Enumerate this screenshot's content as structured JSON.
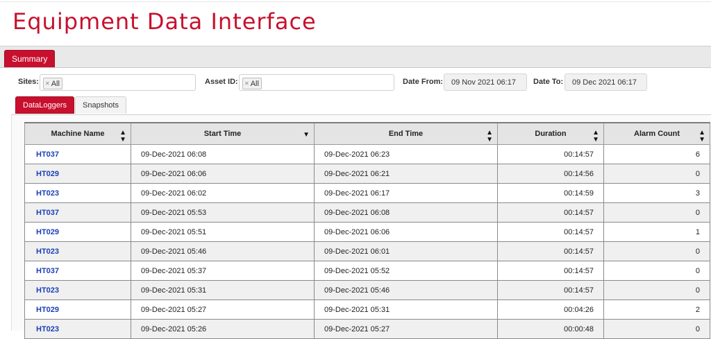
{
  "header": {
    "title": "Equipment Data Interface"
  },
  "tabs": {
    "summary": "Summary"
  },
  "filters": {
    "sites_label": "Sites:",
    "sites_chip": "All",
    "asset_label": "Asset ID:",
    "asset_chip": "All",
    "date_from_label": "Date From:",
    "date_from_value": "09 Nov 2021 06:17",
    "date_to_label": "Date To:",
    "date_to_value": "09 Dec 2021 06:17"
  },
  "subtabs": {
    "dataloggers": "DataLoggers",
    "snapshots": "Snapshots"
  },
  "grid": {
    "columns": [
      "Machine Name",
      "Start Time",
      "End Time",
      "Duration",
      "Alarm Count"
    ],
    "rows": [
      [
        "HT037",
        "09-Dec-2021 06:08",
        "09-Dec-2021 06:23",
        "00:14:57",
        "6"
      ],
      [
        "HT029",
        "09-Dec-2021 06:06",
        "09-Dec-2021 06:21",
        "00:14:56",
        "0"
      ],
      [
        "HT023",
        "09-Dec-2021 06:02",
        "09-Dec-2021 06:17",
        "00:14:59",
        "3"
      ],
      [
        "HT037",
        "09-Dec-2021 05:53",
        "09-Dec-2021 06:08",
        "00:14:57",
        "0"
      ],
      [
        "HT029",
        "09-Dec-2021 05:51",
        "09-Dec-2021 06:06",
        "00:14:57",
        "1"
      ],
      [
        "HT023",
        "09-Dec-2021 05:46",
        "09-Dec-2021 06:01",
        "00:14:57",
        "0"
      ],
      [
        "HT037",
        "09-Dec-2021 05:37",
        "09-Dec-2021 05:52",
        "00:14:57",
        "0"
      ],
      [
        "HT023",
        "09-Dec-2021 05:31",
        "09-Dec-2021 05:46",
        "00:14:57",
        "0"
      ],
      [
        "HT029",
        "09-Dec-2021 05:27",
        "09-Dec-2021 05:31",
        "00:04:26",
        "2"
      ],
      [
        "HT023",
        "09-Dec-2021 05:26",
        "09-Dec-2021 05:27",
        "00:00:48",
        "0"
      ]
    ]
  },
  "colors": {
    "accent": "#c8102e",
    "link": "#1a3fb5"
  },
  "icons": {
    "sort_both": "sort-both-icon",
    "sort_desc": "sort-desc-icon",
    "chip_remove": "chip-remove-icon"
  }
}
